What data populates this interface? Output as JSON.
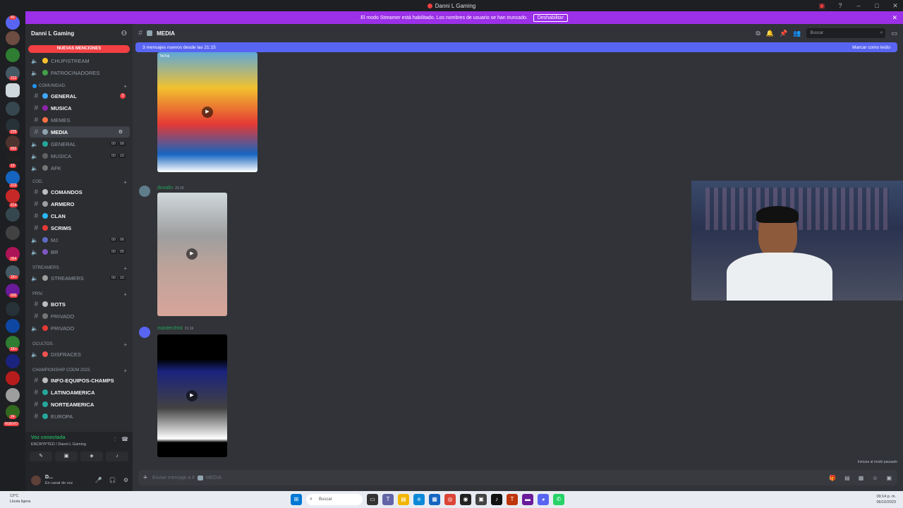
{
  "window": {
    "title": "Danni L Gaming"
  },
  "streamer_bar": {
    "message": "El modo Streamer está habilitado. Los nombres de usuario se han truncado.",
    "button": "Deshabilitar"
  },
  "server_rail": {
    "badges": [
      "40",
      "312",
      "225",
      "892",
      "19",
      "313",
      "814",
      "364",
      "1K+",
      "600",
      "1K+",
      "24"
    ],
    "new_label": "NUEVO"
  },
  "sidebar": {
    "guild_name": "Danni L Gaming",
    "mentions_pill": "NUEVAS MENCIONES",
    "channels": [
      {
        "name": "CHUPISTREAM",
        "type": "voice"
      },
      {
        "name": "PATROCINADORES",
        "type": "voice"
      },
      {
        "name": "COMUNIDAD.",
        "type": "category"
      },
      {
        "name": "GENERAL",
        "type": "text",
        "badge": "3"
      },
      {
        "name": "MUSICA",
        "type": "text"
      },
      {
        "name": "MEMES",
        "type": "text"
      },
      {
        "name": "MEDIA",
        "type": "text",
        "selected": true
      },
      {
        "name": "GENERAL",
        "type": "voice",
        "counts": [
          "00",
          "99"
        ]
      },
      {
        "name": "MUSICA",
        "type": "voice",
        "counts": [
          "00",
          "10"
        ]
      },
      {
        "name": "AFK",
        "type": "voice"
      },
      {
        "name": "COD.",
        "type": "category"
      },
      {
        "name": "COMANDOS",
        "type": "text"
      },
      {
        "name": "ARMERO",
        "type": "text"
      },
      {
        "name": "CLAN",
        "type": "text"
      },
      {
        "name": "SCRIMS",
        "type": "text"
      },
      {
        "name": "MJ",
        "type": "voice",
        "counts": [
          "00",
          "06"
        ]
      },
      {
        "name": "BR",
        "type": "voice",
        "counts": [
          "00",
          "05"
        ]
      },
      {
        "name": "STREAMERS.",
        "type": "category"
      },
      {
        "name": "STREAMERS",
        "type": "voice",
        "counts": [
          "00",
          "10"
        ]
      },
      {
        "name": "PRIV.",
        "type": "category"
      },
      {
        "name": "BOTS",
        "type": "text"
      },
      {
        "name": "PRIVADO",
        "type": "text"
      },
      {
        "name": "PRIVADO",
        "type": "voice"
      },
      {
        "name": "OCULTOS.",
        "type": "category"
      },
      {
        "name": "DISFRACES",
        "type": "voice"
      },
      {
        "name": "CHAMPIONSHIP CODM 2023.",
        "type": "category"
      },
      {
        "name": "INFO-EQUIPOS-CHAMPS",
        "type": "text"
      },
      {
        "name": "LATINOAMERICA",
        "type": "text"
      },
      {
        "name": "NORTEAMERICA",
        "type": "text"
      },
      {
        "name": "EUROPA",
        "type": "text"
      }
    ],
    "voice_status": "Voz conectada",
    "voice_channel": "ENCRYPTED / Danni L Gaming",
    "user_name": "D...",
    "user_status": "En canal de voz"
  },
  "main": {
    "channel_name": "MEDIA",
    "search_placeholder": "Buscar",
    "new_messages_banner": "3 mensajes nuevos desde las 21:15",
    "mark_read": "Marcar como leído",
    "messages": [
      {
        "author": "duvalin",
        "time": "21:15"
      },
      {
        "author": "masterchist",
        "time": "21:16"
      }
    ],
    "tiktok_label": "TikTok",
    "composer_placeholder": "Enviar mensaje a #",
    "composer_channel": "MEDIA",
    "paused_note": "Inmune al modo pausado"
  },
  "taskbar": {
    "temp": "13°C",
    "weather": "Lluvia ligera",
    "search": "Buscar",
    "time": "09:14 p. m.",
    "date": "06/10/2023"
  },
  "colors": {
    "streamer": "#9b30e8",
    "accent": "#5865f2",
    "mention": "#f23f43",
    "online": "#23a559"
  }
}
